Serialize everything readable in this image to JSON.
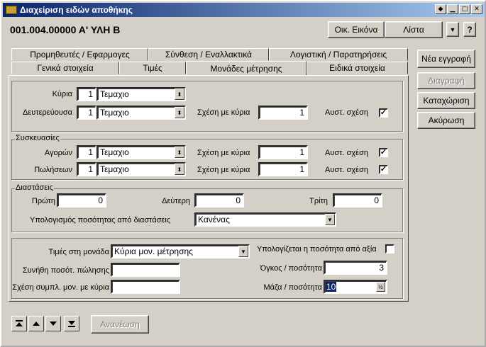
{
  "window": {
    "title": "Διαχείριση ειδών αποθήκης",
    "controls": {
      "pin": "◆",
      "minimize": "▁",
      "maximize": "□",
      "close": "✕"
    }
  },
  "header": {
    "code_name": "001.004.00000 Α' ΥΛΗ Β",
    "btn_image": "Οικ. Εικόνα",
    "btn_list": "Λίστα",
    "btn_help": "?"
  },
  "tabs_row1": [
    "Προμηθευτές / Εφαρμογες",
    "Σύνθεση / Εναλλακτικά",
    "Λογιστική / Παρατηρήσεις"
  ],
  "tabs_row2": [
    "Γενικά στοιχεία",
    "Τιμές",
    "Μονάδες μέτρησης",
    "Ειδικά στοιχεία"
  ],
  "actions": {
    "new": "Νέα εγγραφή",
    "delete": "Διαγραφή",
    "save": "Καταχώριση",
    "cancel": "Ακύρωση"
  },
  "units": {
    "main_label": "Κύρια",
    "main_qty": "1",
    "main_unit": "Τεμαχιο",
    "secondary_label": "Δευτερεύουσα",
    "secondary_qty": "1",
    "secondary_unit": "Τεμαχιο",
    "relation_label": "Σχέση με κύρια",
    "secondary_relation": "1",
    "auto_relation_label": "Αυστ. σχέση",
    "secondary_auto": true
  },
  "packaging": {
    "title": "Συσκευασίες",
    "buy_label": "Αγορών",
    "buy_qty": "1",
    "buy_unit": "Τεμαχιο",
    "buy_relation": "1",
    "buy_auto": true,
    "sell_label": "Πωλήσεων",
    "sell_qty": "1",
    "sell_unit": "Τεμαχιο",
    "sell_relation": "1",
    "sell_auto": true
  },
  "dimensions": {
    "title": "Διαστάσεις",
    "first_label": "Πρώτη",
    "first_value": "0",
    "second_label": "Δεύτερη",
    "second_value": "0",
    "third_label": "Τρίτη",
    "third_value": "0",
    "calc_label": "Υπολογισμός ποσότητας από διαστάσεις",
    "calc_value": "Κανένας"
  },
  "pricing": {
    "price_unit_label": "Τιμές στη μονάδα",
    "price_unit_value": "Κύρια μον. μέτρησης",
    "usual_qty_label": "Συνήθη ποσότ. πώλησης",
    "usual_qty_value": "",
    "compl_relation_label": "Σχέση συμπλ. μον. με κύρια",
    "compl_relation_value": "",
    "calc_from_value_label": "Υπολογίζεται η ποσότητα από αξία",
    "calc_from_value": false,
    "volume_label": "Όγκος / ποσότητα",
    "volume_value": "3",
    "mass_label": "Μάζα / ποσότητα",
    "mass_value": "10"
  },
  "nav": {
    "refresh": "Ανανέωση"
  },
  "colors": {
    "face": "#d4d0c8",
    "title_start": "#0a246a",
    "title_end": "#a6caf0",
    "selection": "#0a246a"
  }
}
